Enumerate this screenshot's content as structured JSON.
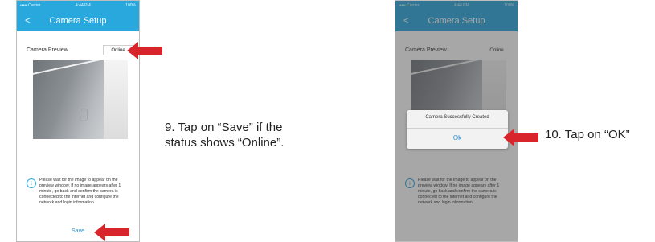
{
  "left_phone": {
    "status_bar": {
      "carrier": "••••• Carrier",
      "time": "4:44 PM",
      "battery": "100%"
    },
    "nav": {
      "back_glyph": "<",
      "title": "Camera Setup"
    },
    "preview_label": "Camera Preview",
    "status_value": "Online",
    "info_text": "Please wait for the image to appear on the preview window. If no image appears after 1 minute, go back and confirm the camera is connected to the internet and configure the network and login information.",
    "save_label": "Save"
  },
  "right_phone": {
    "status_bar": {
      "carrier": "••••• Carrier",
      "time": "4:44 PM",
      "battery": "100%"
    },
    "nav": {
      "back_glyph": "<",
      "title": "Camera Setup"
    },
    "preview_label": "Camera Preview",
    "status_value": "Online",
    "dialog": {
      "message": "Camera Successfully Created",
      "ok_label": "Ok"
    },
    "info_text": "Please wait for the image to appear on the preview window. If no image appears after 1 minute, go back and confirm the camera is connected to the internet and configure the network and login information."
  },
  "captions": {
    "left_line1": "9. Tap on “Save” if the",
    "left_line2": "status shows “Online”.",
    "right": "10. Tap on “OK”"
  },
  "icons": {
    "info": "info-circle-icon",
    "arrow": "red-arrow-icon"
  },
  "colors": {
    "accent": "#29a8de",
    "arrow": "#d8242b",
    "link": "#2c8fd1"
  }
}
